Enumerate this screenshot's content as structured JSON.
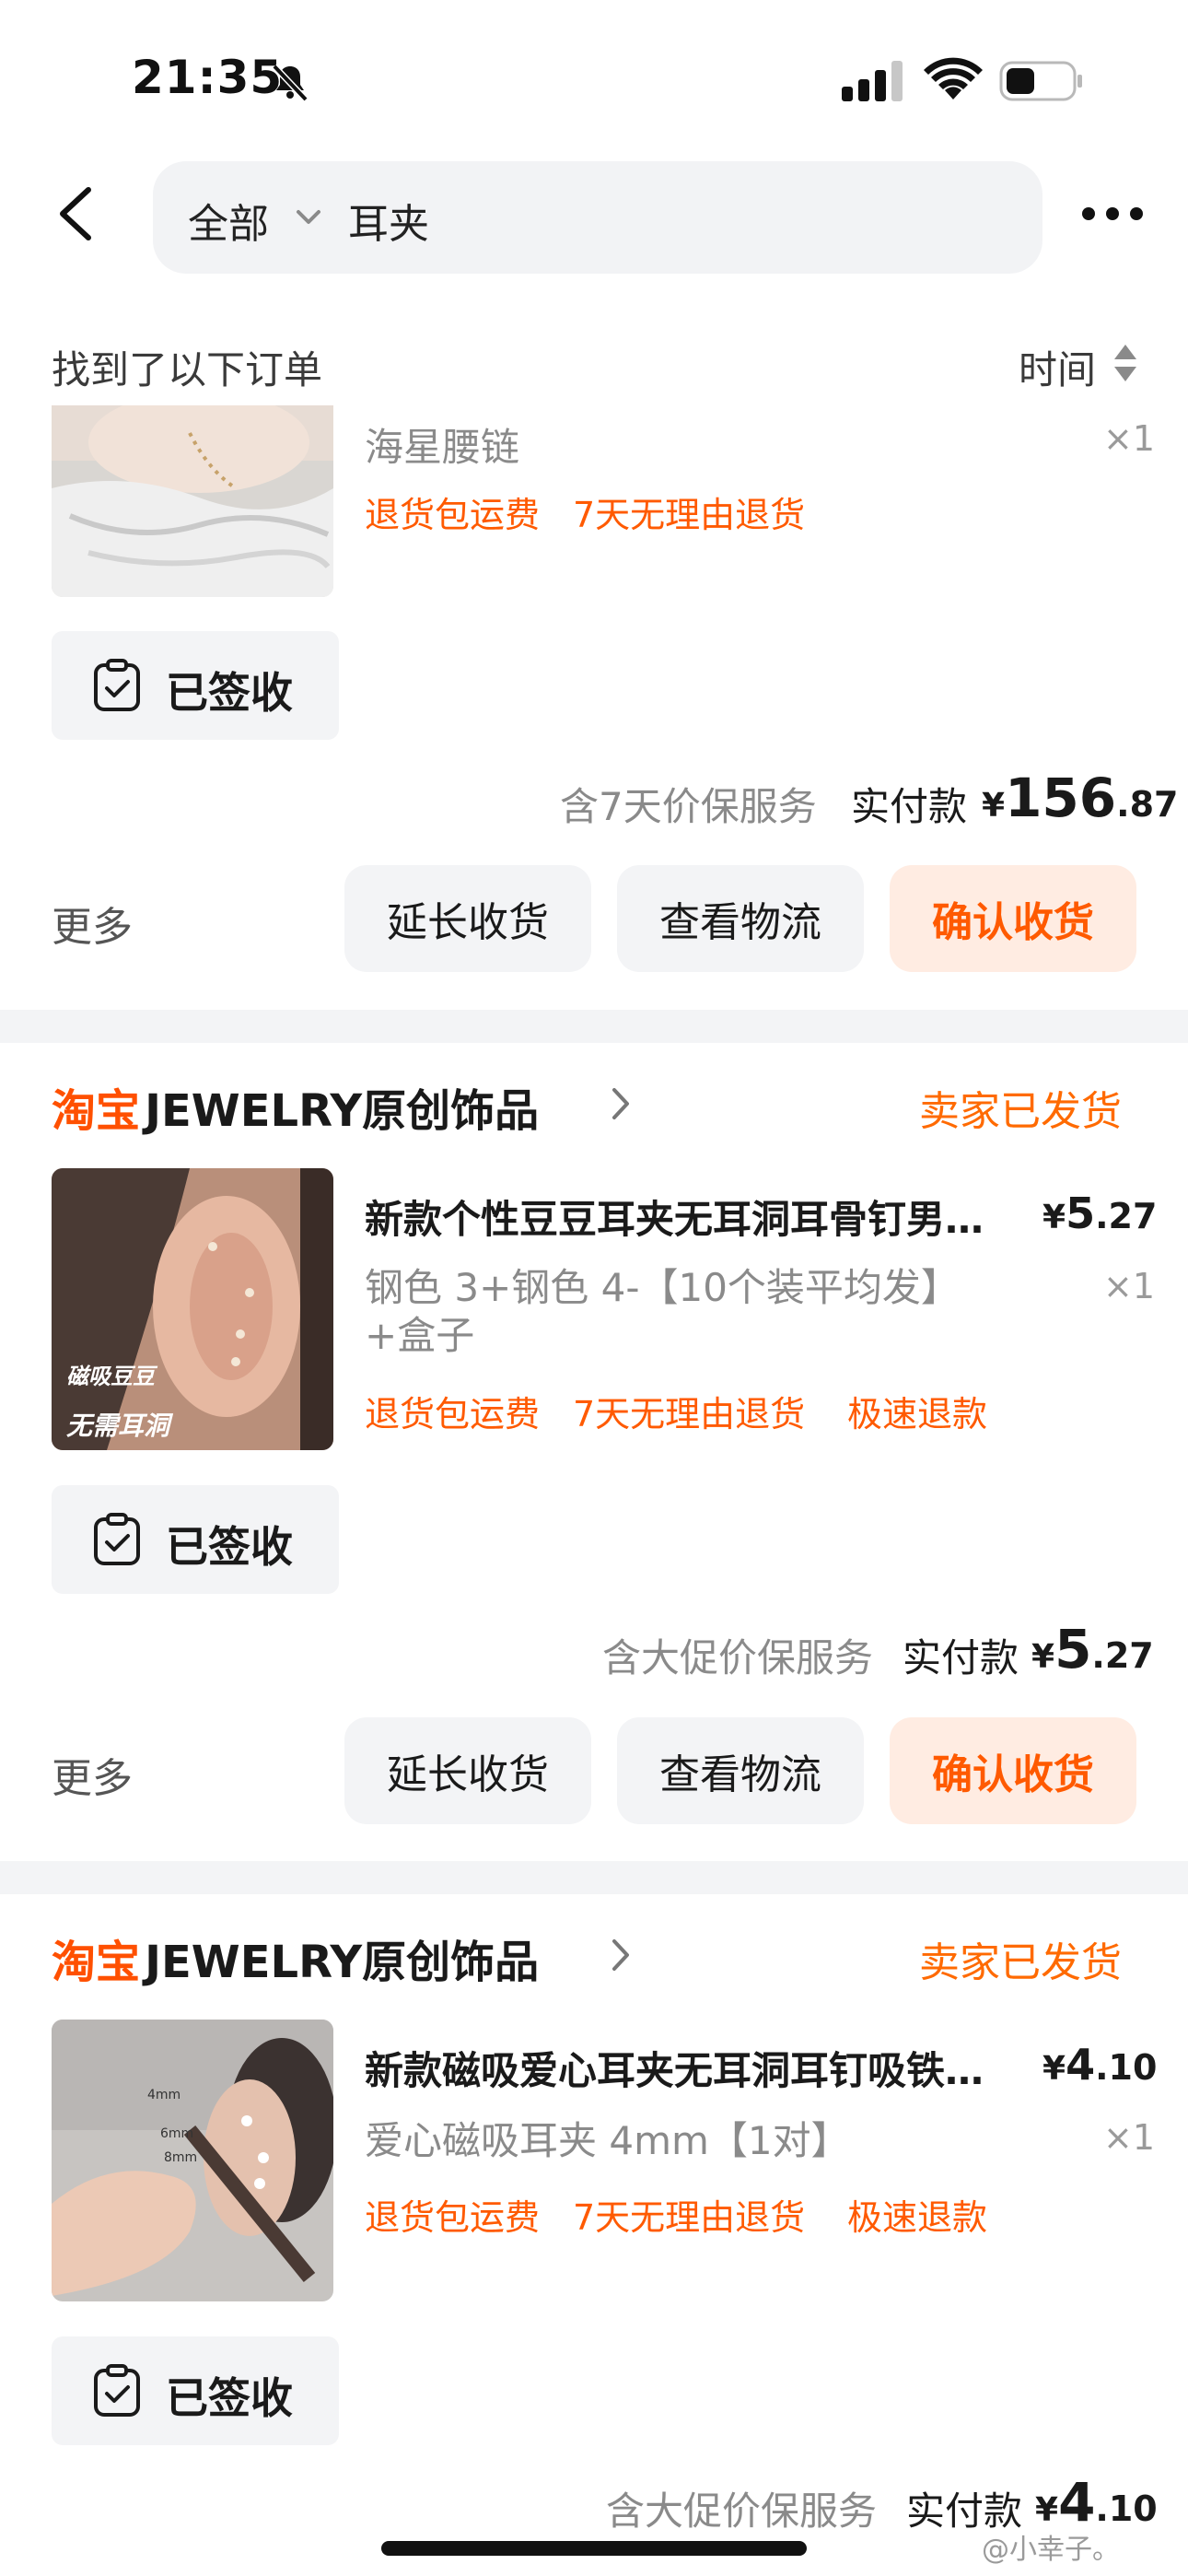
{
  "status_bar": {
    "time": "21:35"
  },
  "nav": {
    "scope": "全部",
    "query": "耳夹"
  },
  "list_header": {
    "found": "找到了以下订单",
    "sort": "时间"
  },
  "order1": {
    "item_title": "海星腰链",
    "qty": "×1",
    "tags": [
      "退货包运费",
      "7天无理由退货"
    ],
    "signed": "已签收",
    "pay_note": "含7天价保服务",
    "pay_label": "实付款",
    "pay_symbol": "¥",
    "pay_int": "156",
    "pay_dec": ".87",
    "more": "更多",
    "btn_extend": "延长收货",
    "btn_logistics": "查看物流",
    "btn_confirm": "确认收货"
  },
  "order2": {
    "shop_brand": "淘宝",
    "shop_name": "JEWELRY原创饰品",
    "status": "卖家已发货",
    "item_title": "新款个性豆豆耳夹无耳洞耳骨钉男…",
    "price_symbol": "¥",
    "price_int": "5",
    "price_dec": ".27",
    "sku": "钢色 3+钢色 4-【10个装平均发】+盒子",
    "qty": "×1",
    "tags": [
      "退货包运费",
      "7天无理由退货",
      "极速退款"
    ],
    "thumb_caption1": "磁吸豆豆",
    "thumb_caption2": "无需耳洞",
    "signed": "已签收",
    "pay_note": "含大促价保服务",
    "pay_label": "实付款",
    "pay_symbol": "¥",
    "pay_int": "5",
    "pay_dec": ".27",
    "more": "更多",
    "btn_extend": "延长收货",
    "btn_logistics": "查看物流",
    "btn_confirm": "确认收货"
  },
  "order3": {
    "shop_brand": "淘宝",
    "shop_name": "JEWELRY原创饰品",
    "status": "卖家已发货",
    "item_title": "新款磁吸爱心耳夹无耳洞耳钉吸铁…",
    "price_symbol": "¥",
    "price_int": "4",
    "price_dec": ".10",
    "sku": "爱心磁吸耳夹 4mm【1对】",
    "qty": "×1",
    "tags": [
      "退货包运费",
      "7天无理由退货",
      "极速退款"
    ],
    "thumb_sizes": [
      "4mm",
      "6mm",
      "8mm"
    ],
    "signed": "已签收",
    "pay_note": "含大促价保服务",
    "pay_label": "实付款",
    "pay_symbol": "¥",
    "pay_int": "4",
    "pay_dec": ".10"
  },
  "watermark": "@小幸子。",
  "colors": {
    "accent": "#ff5a00",
    "chip_bg": "#f3f4f6",
    "confirm_bg": "#ffece2"
  }
}
